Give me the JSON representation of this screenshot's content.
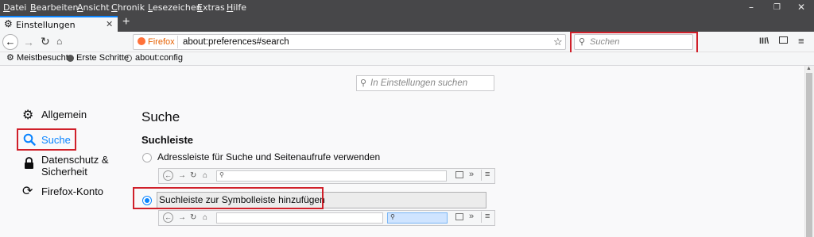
{
  "menu": {
    "items": [
      {
        "first": "D",
        "rest": "atei"
      },
      {
        "first": "B",
        "rest": "earbeiten"
      },
      {
        "first": "A",
        "rest": "nsicht"
      },
      {
        "first": "C",
        "rest": "hronik"
      },
      {
        "first": "L",
        "rest": "esezeichen"
      },
      {
        "first": "E",
        "rest": "xtras"
      },
      {
        "first": "H",
        "rest": "ilfe"
      }
    ]
  },
  "tab": {
    "title": "Einstellungen",
    "new_tab": "+"
  },
  "urlbar": {
    "identity": "Firefox",
    "url": "about:preferences#search"
  },
  "searchbar": {
    "placeholder": "Suchen"
  },
  "bookmarks": [
    {
      "label": "Meistbesucht",
      "icon": "gear-icon"
    },
    {
      "label": "Erste Schritte",
      "icon": "firefox-icon"
    },
    {
      "label": "about:config",
      "icon": "globe-icon"
    }
  ],
  "prefs_search": {
    "placeholder": "In Einstellungen suchen"
  },
  "sidebar": {
    "items": [
      {
        "label": "Allgemein",
        "icon": "gear-icon"
      },
      {
        "label": "Suche",
        "icon": "search-icon",
        "selected": true
      },
      {
        "label_line1": "Datenschutz &",
        "label_line2": "Sicherheit",
        "icon": "lock-icon"
      },
      {
        "label": "Firefox-Konto",
        "icon": "sync-icon"
      }
    ]
  },
  "main": {
    "title": "Suche",
    "section_title": "Suchleiste",
    "options": [
      {
        "label": "Adressleiste für Suche und Seitenaufrufe verwenden",
        "checked": false
      },
      {
        "label": "Suchleiste zur Symbolleiste hinzufügen",
        "checked": true
      }
    ]
  },
  "colors": {
    "accent": "#0a84ff",
    "highlight": "#d0202a",
    "selected_text": "#0a84ff"
  }
}
